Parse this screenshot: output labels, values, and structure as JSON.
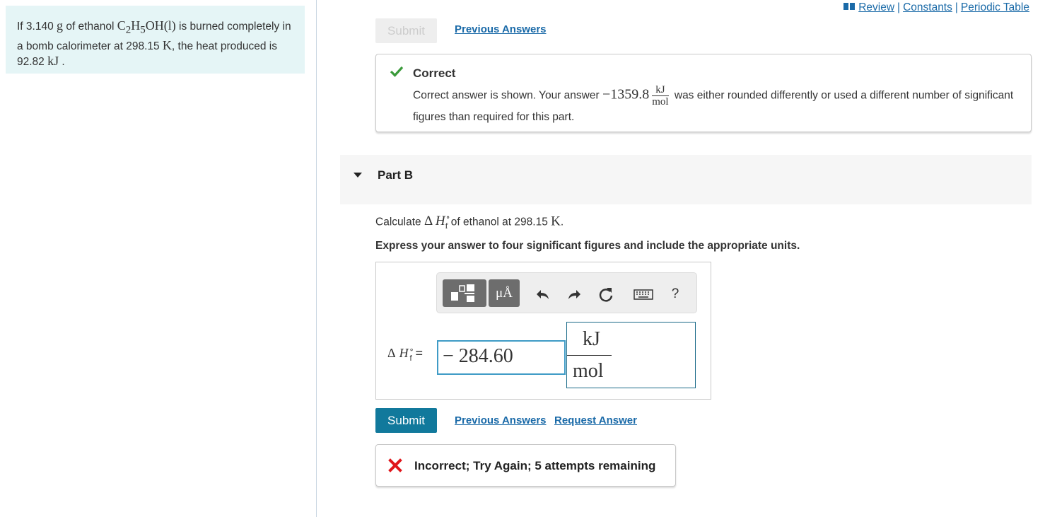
{
  "problem": {
    "text_before": "If 3.140 ",
    "mass_unit": "g",
    "text_mid1": " of ethanol ",
    "formula_c": "C",
    "sub_c": "2",
    "formula_h": "H",
    "sub_h": "5",
    "formula_rest": "OH(l)",
    "text_mid2": " is burned completely in a bomb calorimeter at 298.15 ",
    "temp_unit": "K",
    "text_mid3": ", the heat produced is 92.82 ",
    "heat_unit": "kJ",
    "text_end": " ."
  },
  "toplinks": {
    "review": "Review",
    "constants": "Constants",
    "periodic": "Periodic Table",
    "separator": "|"
  },
  "partA": {
    "submit_label": "Submit",
    "previous_answers": "Previous Answers",
    "feedback_title": "Correct",
    "feedback_prefix": "Correct answer is shown. Your answer ",
    "feedback_value": "−1359.8",
    "feedback_unit_num": "kJ",
    "feedback_unit_den": "mol",
    "feedback_suffix": " was either rounded differently or used a different number of significant figures than required for this part."
  },
  "partB": {
    "title": "Part B",
    "question_prefix": "Calculate ",
    "question_symbol_delta": "Δ",
    "question_symbol_h": "H",
    "question_symbol_sup": "∘",
    "question_symbol_sub": "f",
    "question_suffix": " of ethanol at 298.15 ",
    "question_temp_unit": "K",
    "question_end": ".",
    "instruction": "Express your answer to four significant figures and include the appropriate units.",
    "toolbar": {
      "units_label": "μÅ",
      "help_label": "?"
    },
    "answer_label_delta": "Δ",
    "answer_label_h": "H",
    "answer_label_sup": "∘",
    "answer_label_sub": "f",
    "answer_label_eq": " =",
    "answer_value": "− 284.60",
    "unit_numerator": "kJ",
    "unit_denominator": "mol",
    "submit_label": "Submit",
    "previous_answers": "Previous Answers",
    "request_answer": "Request Answer",
    "incorrect_message": "Incorrect; Try Again; 5 attempts remaining"
  },
  "colors": {
    "accent": "#11799c",
    "link": "#1a6aa8",
    "correct_green": "#3a9a3a",
    "incorrect_red": "#e0161b",
    "problem_bg": "#e5f5f6"
  }
}
